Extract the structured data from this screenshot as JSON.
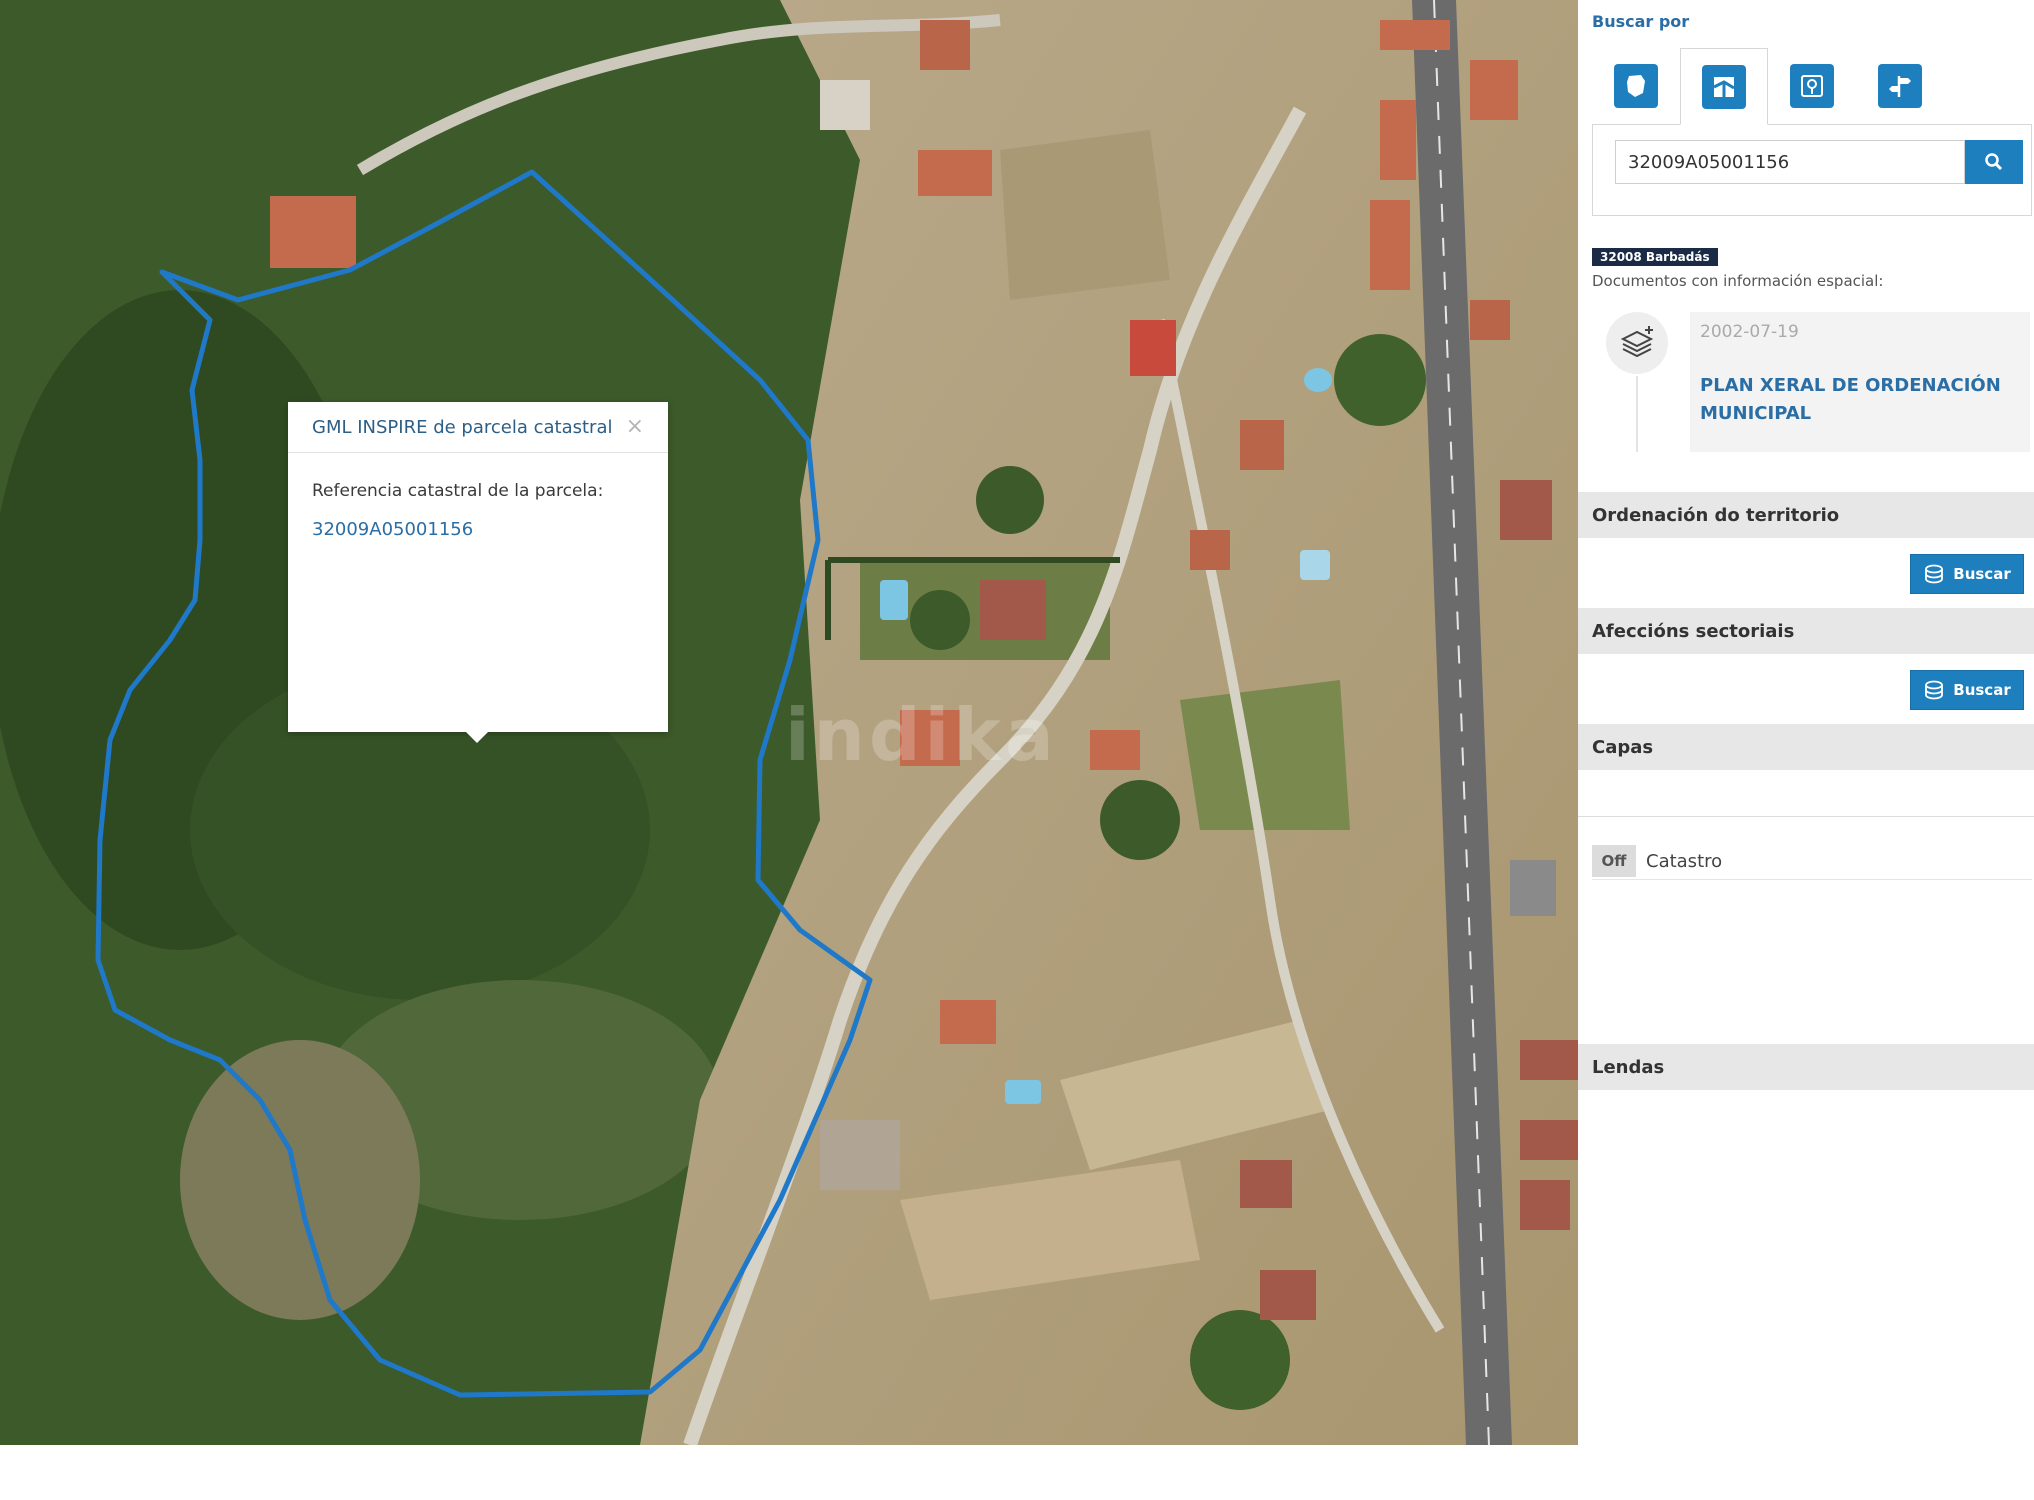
{
  "popup": {
    "title": "GML INSPIRE de parcela catastral",
    "close": "×",
    "label": "Referencia catastral de la parcela:",
    "reference": "32009A05001156"
  },
  "watermark": "indika",
  "panel": {
    "search_by_label": "Buscar por",
    "tabs": [
      {
        "name": "municipality-tab",
        "icon": "map-region-icon",
        "active": false
      },
      {
        "name": "parcel-tab",
        "icon": "parcel-icon",
        "active": true
      },
      {
        "name": "location-tab",
        "icon": "location-pin-icon",
        "active": false
      },
      {
        "name": "address-tab",
        "icon": "signpost-icon",
        "active": false
      }
    ],
    "search_value": "32009A05001156",
    "municipality_badge": "32008 Barbadás",
    "documents_label": "Documentos con información espacial:",
    "document": {
      "date": "2002-07-19",
      "title": "PLAN XERAL DE ORDENACIÓN MUNICIPAL"
    },
    "sections": {
      "ordenacion": "Ordenación do territorio",
      "afeccions": "Afeccións sectoriais",
      "capas": "Capas",
      "lendas": "Lendas"
    },
    "buscar_label": "Buscar",
    "layer": {
      "state": "Off",
      "name": "Catastro"
    }
  },
  "colors": {
    "accent": "#1e7fbf",
    "parcel_outline": "#1f78c8",
    "badge_bg": "#1b2b45"
  }
}
